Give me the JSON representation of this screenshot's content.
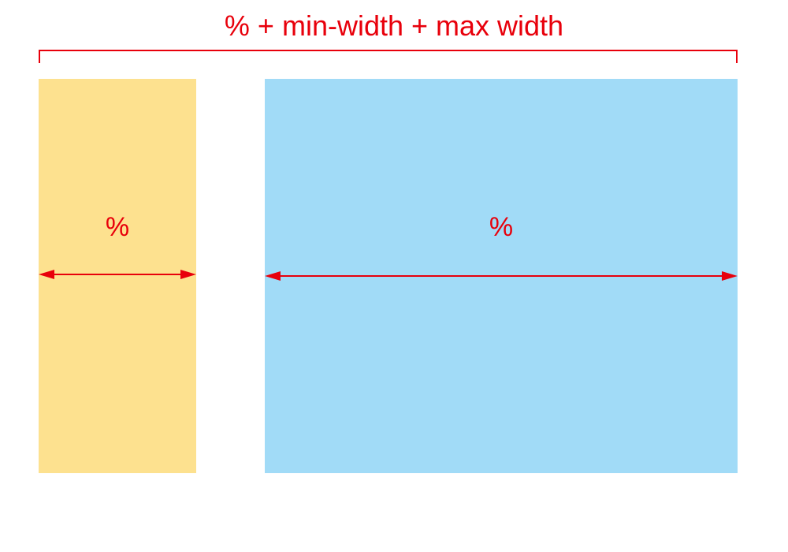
{
  "title": "% + min-width + max width",
  "columns": [
    {
      "label": "%"
    },
    {
      "label": "%"
    }
  ],
  "colors": {
    "annotation": "#e8000b",
    "left_column": "#fde18f",
    "right_column": "#a1dbf7",
    "background": "#ffffff"
  }
}
